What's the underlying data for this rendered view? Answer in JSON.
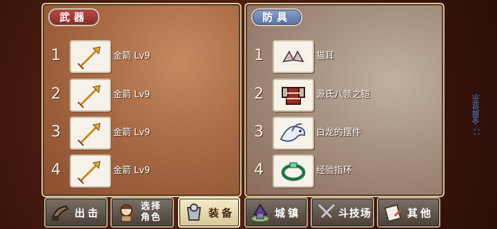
{
  "weapons": {
    "title": "武器",
    "slots": [
      {
        "num": "1",
        "name": "金箭 Lv9",
        "icon": "golden-arrow-icon"
      },
      {
        "num": "2",
        "name": "金箭 Lv9",
        "icon": "golden-arrow-icon"
      },
      {
        "num": "3",
        "name": "金箭 Lv9",
        "icon": "golden-arrow-icon"
      },
      {
        "num": "4",
        "name": "金箭 Lv9",
        "icon": "golden-arrow-icon"
      }
    ]
  },
  "armor": {
    "title": "防具",
    "slots": [
      {
        "num": "1",
        "name": "猫耳",
        "icon": "cat-ears-icon"
      },
      {
        "num": "2",
        "name": "源氏八领之铠",
        "icon": "armor-icon"
      },
      {
        "num": "3",
        "name": "白龙的摆件",
        "icon": "white-dragon-icon"
      },
      {
        "num": "4",
        "name": "经验指环",
        "icon": "ring-icon"
      }
    ]
  },
  "side": {
    "fullscreen_label": "全屏显示"
  },
  "tabs": [
    {
      "label": "出击",
      "icon": "sortie-icon",
      "active": false
    },
    {
      "label": "选择",
      "label2": "角色",
      "icon": "character-icon",
      "active": false
    },
    {
      "label": "装备",
      "icon": "equipment-icon",
      "active": true
    },
    {
      "label": "城镇",
      "icon": "town-icon",
      "active": false
    },
    {
      "label": "斗技场",
      "icon": "arena-icon",
      "active": false
    },
    {
      "label": "其他",
      "icon": "other-icon",
      "active": false
    }
  ]
}
